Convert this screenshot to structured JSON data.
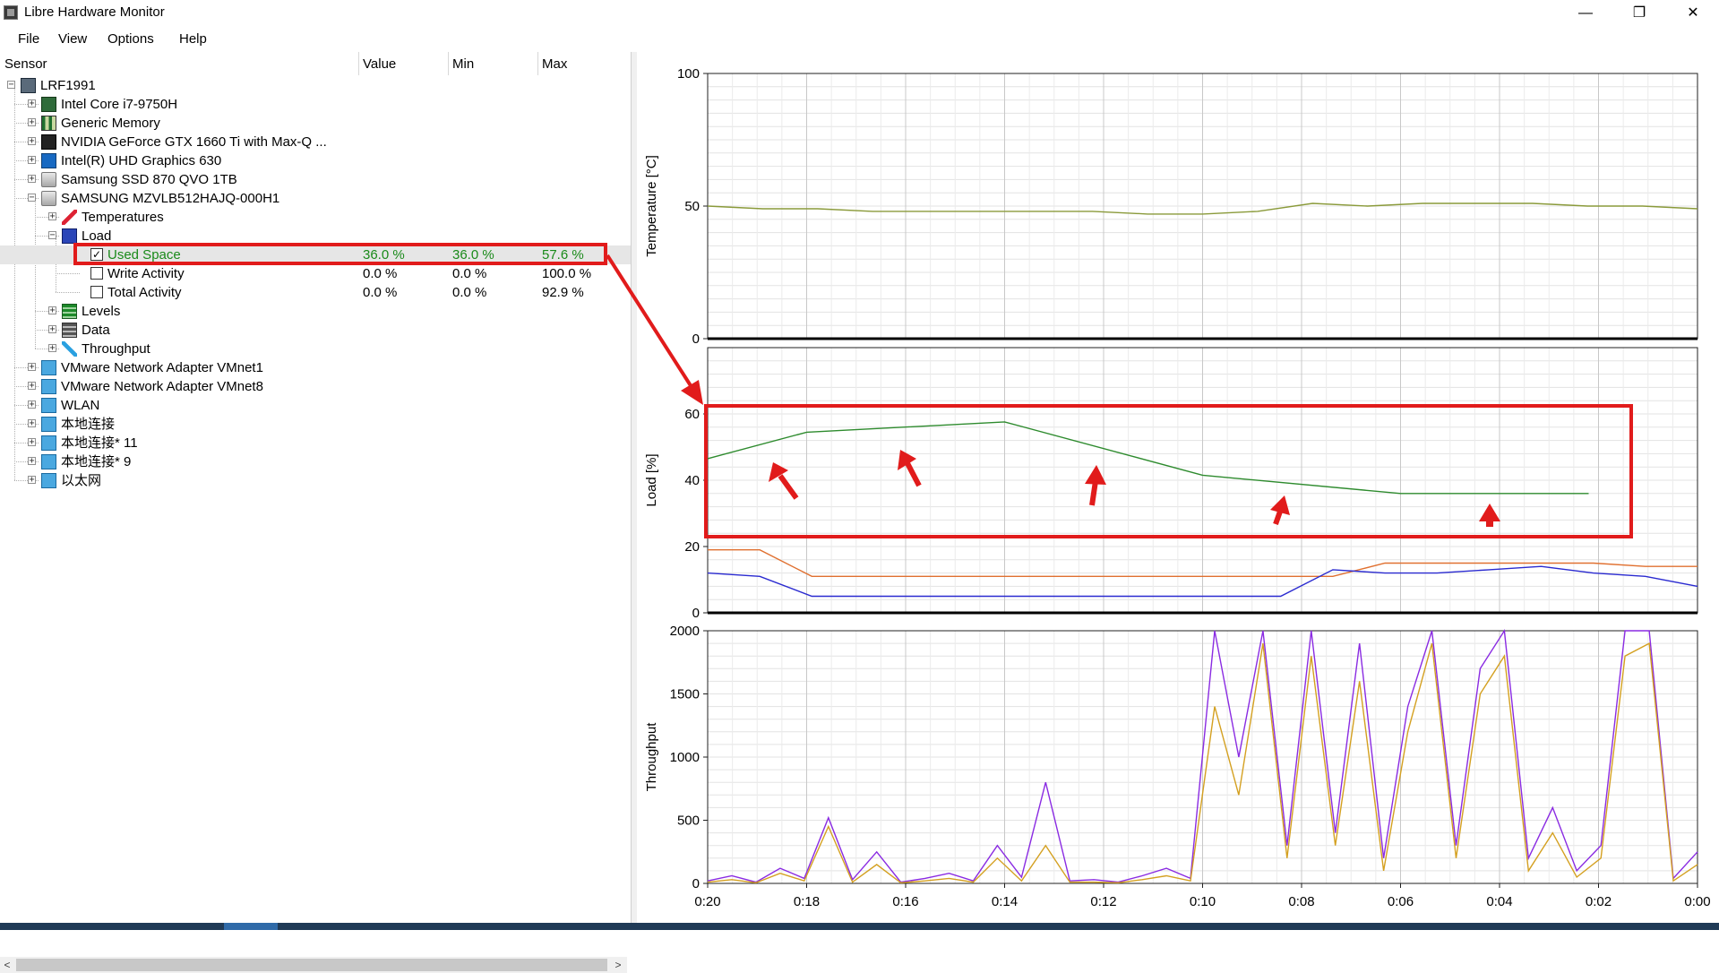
{
  "window": {
    "title": "Libre Hardware Monitor",
    "controls": {
      "minimize": "—",
      "maximize": "❐",
      "close": "✕"
    }
  },
  "menu": [
    "File",
    "View",
    "Options",
    "Help"
  ],
  "columns": {
    "sensor": "Sensor",
    "value": "Value",
    "min": "Min",
    "max": "Max"
  },
  "tree": [
    {
      "id": "root",
      "label": "LRF1991",
      "icon": "computer-icon",
      "level": 0,
      "expander": "minus"
    },
    {
      "id": "cpu",
      "label": "Intel Core i7-9750H",
      "icon": "cpu-icon",
      "level": 1,
      "expander": "plus"
    },
    {
      "id": "mem",
      "label": "Generic Memory",
      "icon": "memory-icon",
      "level": 1,
      "expander": "plus"
    },
    {
      "id": "gpu-nvidia",
      "label": "NVIDIA GeForce GTX 1660 Ti with Max-Q ...",
      "icon": "nvidia-icon",
      "level": 1,
      "expander": "plus"
    },
    {
      "id": "gpu-intel",
      "label": "Intel(R) UHD Graphics 630",
      "icon": "intel-icon",
      "level": 1,
      "expander": "plus"
    },
    {
      "id": "ssd-870",
      "label": "Samsung SSD 870 QVO 1TB",
      "icon": "drive-icon",
      "level": 1,
      "expander": "plus"
    },
    {
      "id": "ssd-mzv",
      "label": "SAMSUNG MZVLB512HAJQ-000H1",
      "icon": "drive-icon",
      "level": 1,
      "expander": "minus"
    },
    {
      "id": "temps",
      "label": "Temperatures",
      "icon": "thermometer-icon",
      "level": 2,
      "expander": "plus"
    },
    {
      "id": "load",
      "label": "Load",
      "icon": "load-icon",
      "level": 2,
      "expander": "minus"
    },
    {
      "id": "used-space",
      "label": "Used Space",
      "level": 3,
      "checkbox": true,
      "checked": true,
      "value": "36.0 %",
      "min": "36.0 %",
      "max": "57.6 %",
      "selected": true
    },
    {
      "id": "write-activity",
      "label": "Write Activity",
      "level": 3,
      "checkbox": true,
      "checked": false,
      "value": "0.0 %",
      "min": "0.0 %",
      "max": "100.0 %"
    },
    {
      "id": "total-activity",
      "label": "Total Activity",
      "level": 3,
      "checkbox": true,
      "checked": false,
      "value": "0.0 %",
      "min": "0.0 %",
      "max": "92.9 %"
    },
    {
      "id": "levels",
      "label": "Levels",
      "icon": "levels-icon",
      "level": 2,
      "expander": "plus"
    },
    {
      "id": "data",
      "label": "Data",
      "icon": "data-icon",
      "level": 2,
      "expander": "plus"
    },
    {
      "id": "throughput",
      "label": "Throughput",
      "icon": "throughput-icon",
      "level": 2,
      "expander": "plus"
    },
    {
      "id": "vmnet1",
      "label": "VMware Network Adapter VMnet1",
      "icon": "network-icon",
      "level": 1,
      "expander": "plus"
    },
    {
      "id": "vmnet8",
      "label": "VMware Network Adapter VMnet8",
      "icon": "network-icon",
      "level": 1,
      "expander": "plus"
    },
    {
      "id": "wlan",
      "label": "WLAN",
      "icon": "network-icon",
      "level": 1,
      "expander": "plus"
    },
    {
      "id": "local1",
      "label": "本地连接",
      "icon": "network-icon",
      "level": 1,
      "expander": "plus"
    },
    {
      "id": "local11",
      "label": "本地连接* 11",
      "icon": "network-icon",
      "level": 1,
      "expander": "plus"
    },
    {
      "id": "local9",
      "label": "本地连接* 9",
      "icon": "network-icon",
      "level": 1,
      "expander": "plus"
    },
    {
      "id": "ethernet",
      "label": "以太网",
      "icon": "network-icon",
      "level": 1,
      "expander": "plus"
    }
  ],
  "colors": {
    "temperature": "#8a9a3a",
    "used_space": "#2e8b2e",
    "load_orange": "#e07030",
    "load_blue": "#2a2ad0",
    "throughput_purple": "#8a2be2",
    "throughput_gold": "#d4a020",
    "annotation": "#e11b1b"
  },
  "chart_data": [
    {
      "type": "line",
      "ylabel": "Temperature [°C]",
      "ylim": [
        0,
        100
      ],
      "yticks": [
        "100",
        "50",
        "0"
      ],
      "series": [
        {
          "values": [
            50,
            49,
            49,
            48,
            48,
            48,
            48,
            48,
            47,
            47,
            48,
            51,
            50,
            51,
            51,
            51,
            50,
            50,
            49
          ]
        }
      ]
    },
    {
      "type": "line",
      "ylabel": "Load [%]",
      "ylim": [
        0,
        80
      ],
      "yticks": [
        "60",
        "40",
        "20",
        "0"
      ],
      "series": [
        {
          "name": "Used Space",
          "x": [
            20,
            18,
            14,
            10,
            6,
            2.2
          ],
          "values": [
            46.5,
            54.5,
            57.6,
            41.5,
            36,
            36
          ]
        },
        {
          "values": [
            19,
            19,
            11,
            11,
            11,
            11,
            11,
            11,
            11,
            11,
            11,
            11,
            11,
            15,
            15,
            15,
            15,
            15,
            14,
            14
          ]
        },
        {
          "values": [
            12,
            11,
            5,
            5,
            5,
            5,
            5,
            5,
            5,
            5,
            5,
            5,
            13,
            12,
            12,
            13,
            14,
            12,
            11,
            8
          ]
        }
      ]
    },
    {
      "type": "line",
      "ylabel": "Throughput",
      "ylim": [
        0,
        2000
      ],
      "yticks": [
        "2000",
        "1500",
        "1000",
        "500",
        "0"
      ],
      "x_ticks": [
        "0:20",
        "0:18",
        "0:16",
        "0:14",
        "0:12",
        "0:10",
        "0:08",
        "0:06",
        "0:04",
        "0:02",
        "0:00"
      ],
      "series": [
        {
          "values": [
            20,
            60,
            10,
            120,
            40,
            520,
            30,
            250,
            10,
            40,
            80,
            20,
            300,
            50,
            800,
            20,
            30,
            10,
            60,
            120,
            40,
            2000,
            1000,
            2000,
            300,
            2000,
            400,
            1900,
            200,
            1400,
            2000,
            300,
            1700,
            2000,
            200,
            600,
            100,
            300,
            2000,
            2000,
            40,
            250
          ]
        },
        {
          "values": [
            10,
            30,
            5,
            80,
            20,
            450,
            10,
            150,
            5,
            20,
            40,
            10,
            200,
            20,
            300,
            10,
            10,
            5,
            30,
            60,
            20,
            1400,
            700,
            1900,
            200,
            1800,
            300,
            1600,
            100,
            1200,
            1900,
            200,
            1500,
            1800,
            100,
            400,
            50,
            200,
            1800,
            1900,
            20,
            150
          ]
        }
      ]
    }
  ]
}
